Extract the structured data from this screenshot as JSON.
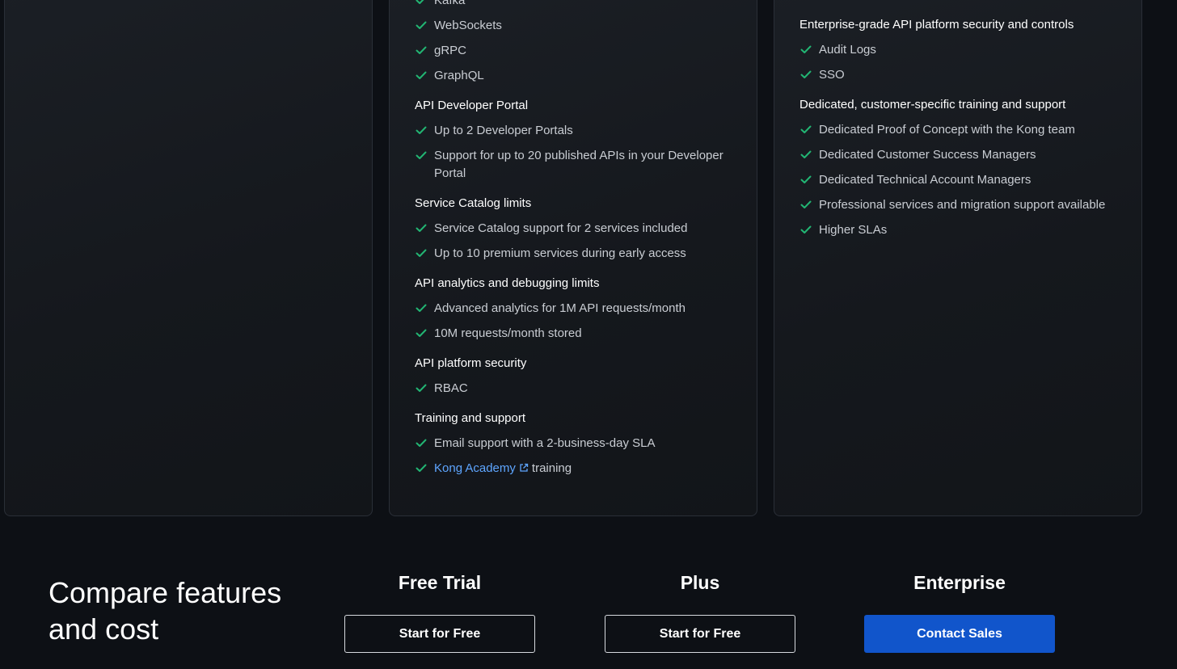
{
  "plus_card": {
    "protocols": [
      "Kafka",
      "WebSockets",
      "gRPC",
      "GraphQL"
    ],
    "groups": [
      {
        "title": "API Developer Portal",
        "items": [
          "Up to 2 Developer Portals",
          "Support for up to 20 published APIs in your Developer Portal"
        ]
      },
      {
        "title": "Service Catalog limits",
        "items": [
          "Service Catalog support for 2 services included",
          "Up to 10 premium services during early access"
        ]
      },
      {
        "title": "API analytics and debugging limits",
        "items": [
          "Advanced analytics for 1M API requests/month",
          "10M requests/month stored"
        ]
      },
      {
        "title": "API platform security",
        "items": [
          "RBAC"
        ]
      },
      {
        "title": "Training and support",
        "items": [
          "Email support with a 2-business-day SLA"
        ]
      }
    ],
    "academy_link": "Kong Academy",
    "academy_suffix": "training"
  },
  "enterprise_card": {
    "groups": [
      {
        "title": "Enterprise-grade API platform security and controls",
        "items": [
          "Audit Logs",
          "SSO"
        ]
      },
      {
        "title": "Dedicated, customer-specific training and support",
        "items": [
          "Dedicated Proof of Concept with the Kong team",
          "Dedicated Customer Success Managers",
          "Dedicated Technical Account Managers",
          "Professional services and migration support available",
          "Higher SLAs"
        ]
      }
    ]
  },
  "compare": {
    "title_line1": "Compare features",
    "title_line2": "and cost"
  },
  "plans": [
    {
      "name": "Free Trial",
      "button": "Start for Free"
    },
    {
      "name": "Plus",
      "button": "Start for Free"
    },
    {
      "name": "Enterprise",
      "button": "Contact Sales"
    }
  ],
  "icons": {
    "check": "check-icon",
    "external": "external-link-icon"
  },
  "colors": {
    "check": "#22b573",
    "link": "#5ea5ff",
    "primary_button": "#1155cb"
  }
}
